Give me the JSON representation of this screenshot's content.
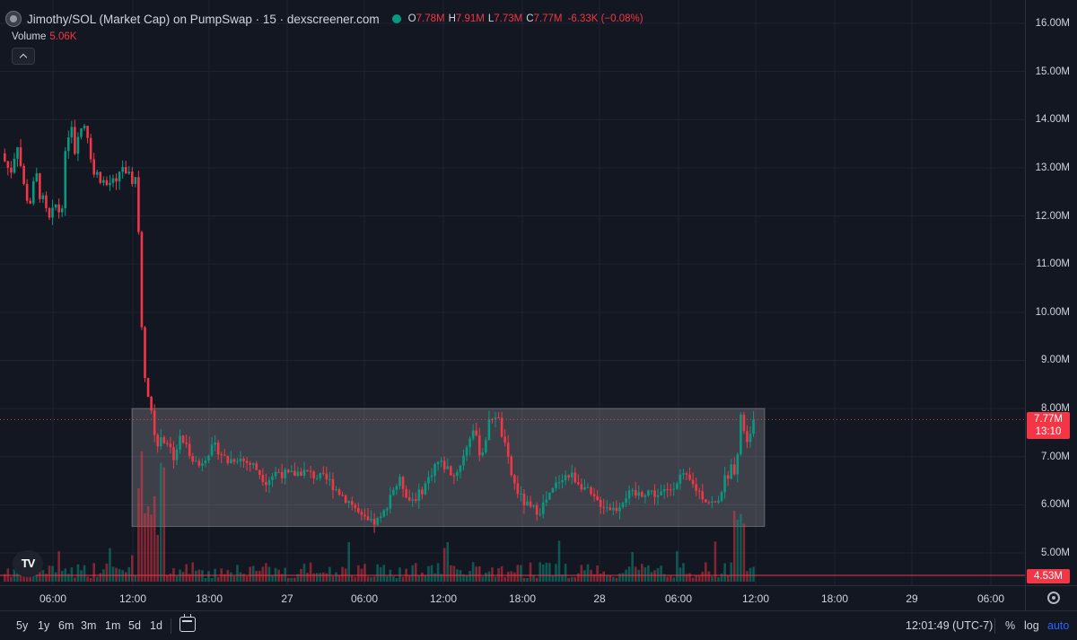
{
  "legend": {
    "title": "Jimothy/SOL (Market Cap) on PumpSwap · 15 · dexscreener.com",
    "o_key": "O",
    "o_val": "7.78M",
    "h_key": "H",
    "h_val": "7.91M",
    "l_key": "L",
    "l_val": "7.73M",
    "c_key": "C",
    "c_val": "7.77M",
    "change": "-6.33K (−0.08%)"
  },
  "volume_legend": {
    "label": "Volume",
    "value": "5.06K"
  },
  "price_axis": {
    "ticks": [
      "16.00M",
      "15.00M",
      "14.00M",
      "13.00M",
      "12.00M",
      "11.00M",
      "10.00M",
      "9.00M",
      "8.00M",
      "7.00M",
      "6.00M",
      "5.00M"
    ],
    "current_price": "7.77M",
    "countdown": "13:10",
    "volume_label": "4.53M"
  },
  "time_axis": {
    "ticks": [
      "06:00",
      "12:00",
      "18:00",
      "27",
      "06:00",
      "12:00",
      "18:00",
      "28",
      "06:00",
      "12:00",
      "18:00",
      "29",
      "06:00"
    ]
  },
  "bottom_bar": {
    "ranges": [
      "5y",
      "1y",
      "6m",
      "3m",
      "1m",
      "5d",
      "1d"
    ],
    "clock": "12:01:49 (UTC-7)",
    "percent": "%",
    "log": "log",
    "auto": "auto"
  },
  "colors": {
    "up": "#089981",
    "down": "#f23645",
    "background": "#131722",
    "grid": "#1f2330",
    "box": "#ffffff"
  },
  "chart_data": {
    "type": "candlestick",
    "timeframe": "15",
    "price_range": [
      4.4,
      16.4
    ],
    "current_price": 7.77,
    "rectangle": {
      "price_top": 8.0,
      "price_bottom": 5.55
    },
    "anchors": [
      [
        0,
        13.3
      ],
      [
        10,
        12.9
      ],
      [
        18,
        13.6
      ],
      [
        25,
        12.6
      ],
      [
        32,
        12.3
      ],
      [
        40,
        12.8
      ],
      [
        48,
        12.1
      ],
      [
        55,
        11.8
      ],
      [
        62,
        12.3
      ],
      [
        66,
        12.0
      ],
      [
        70,
        12.8
      ],
      [
        74,
        13.7
      ],
      [
        78,
        14.1
      ],
      [
        82,
        13.4
      ],
      [
        86,
        13.9
      ],
      [
        90,
        13.8
      ],
      [
        94,
        14.0
      ],
      [
        98,
        13.6
      ],
      [
        104,
        12.8
      ],
      [
        110,
        12.9
      ],
      [
        116,
        12.6
      ],
      [
        122,
        12.7
      ],
      [
        128,
        12.5
      ],
      [
        134,
        13.2
      ],
      [
        140,
        12.6
      ],
      [
        145,
        12.8
      ],
      [
        150,
        12.8
      ],
      [
        152,
        12.5
      ],
      [
        154,
        11.2
      ],
      [
        156,
        9.8
      ],
      [
        158,
        9.0
      ],
      [
        162,
        8.5
      ],
      [
        166,
        8.0
      ],
      [
        170,
        7.6
      ],
      [
        175,
        7.2
      ],
      [
        180,
        7.4
      ],
      [
        186,
        7.3
      ],
      [
        192,
        7.0
      ],
      [
        200,
        7.4
      ],
      [
        210,
        7.1
      ],
      [
        220,
        6.8
      ],
      [
        230,
        7.1
      ],
      [
        240,
        7.2
      ],
      [
        252,
        6.9
      ],
      [
        262,
        7.0
      ],
      [
        272,
        6.9
      ],
      [
        282,
        6.8
      ],
      [
        295,
        6.5
      ],
      [
        308,
        6.7
      ],
      [
        320,
        6.6
      ],
      [
        335,
        6.7
      ],
      [
        350,
        6.6
      ],
      [
        365,
        6.5
      ],
      [
        380,
        6.2
      ],
      [
        392,
        6.0
      ],
      [
        402,
        5.7
      ],
      [
        412,
        5.6
      ],
      [
        424,
        5.7
      ],
      [
        435,
        6.3
      ],
      [
        445,
        6.5
      ],
      [
        455,
        6.1
      ],
      [
        465,
        6.2
      ],
      [
        475,
        6.5
      ],
      [
        485,
        6.9
      ],
      [
        495,
        6.8
      ],
      [
        505,
        6.6
      ],
      [
        515,
        7.0
      ],
      [
        525,
        7.6
      ],
      [
        535,
        7.0
      ],
      [
        545,
        7.8
      ],
      [
        552,
        7.9
      ],
      [
        560,
        7.3
      ],
      [
        570,
        6.5
      ],
      [
        580,
        6.1
      ],
      [
        590,
        5.9
      ],
      [
        600,
        5.9
      ],
      [
        612,
        6.2
      ],
      [
        624,
        6.6
      ],
      [
        636,
        6.6
      ],
      [
        648,
        6.4
      ],
      [
        660,
        6.1
      ],
      [
        672,
        6.0
      ],
      [
        684,
        5.9
      ],
      [
        696,
        6.2
      ],
      [
        708,
        6.2
      ],
      [
        720,
        6.3
      ],
      [
        732,
        6.2
      ],
      [
        744,
        6.3
      ],
      [
        756,
        6.6
      ],
      [
        766,
        6.5
      ],
      [
        776,
        6.3
      ],
      [
        786,
        6.1
      ],
      [
        796,
        6.0
      ],
      [
        806,
        6.5
      ],
      [
        814,
        6.8
      ],
      [
        819,
        6.7
      ],
      [
        822,
        7.6
      ],
      [
        825,
        8.0
      ],
      [
        828,
        7.4
      ],
      [
        832,
        7.4
      ],
      [
        838,
        7.8
      ]
    ]
  }
}
